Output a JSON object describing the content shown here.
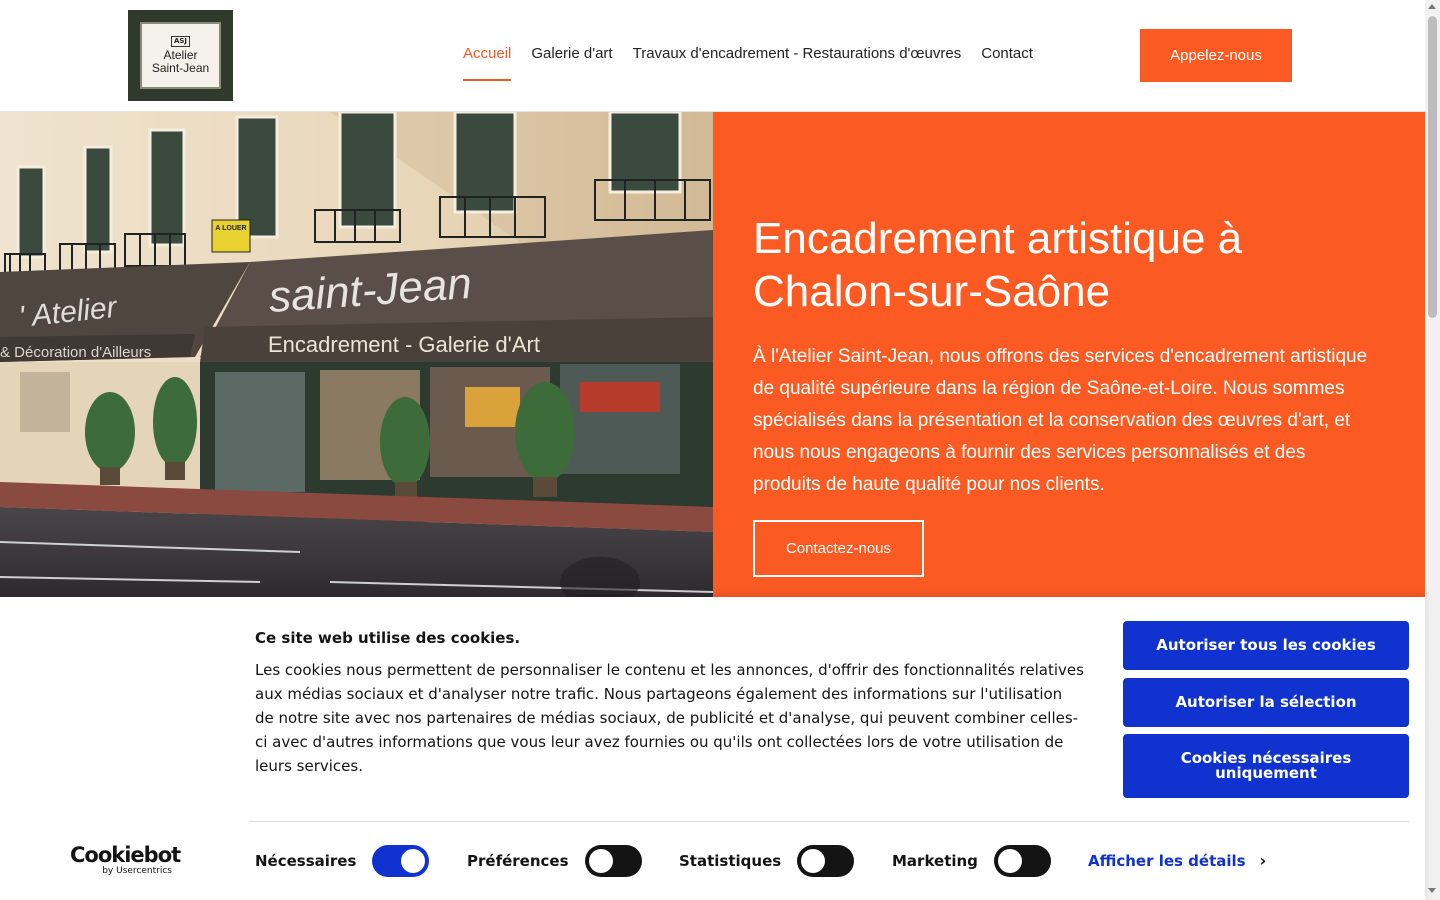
{
  "logo": {
    "mark": "ASJ",
    "line1": "Atelier",
    "line2": "Saint-Jean"
  },
  "nav": {
    "items": [
      {
        "label": "Accueil",
        "active": true
      },
      {
        "label": "Galerie d'art",
        "active": false
      },
      {
        "label": "Travaux d'encadrement - Restaurations d'œuvres",
        "active": false
      },
      {
        "label": "Contact",
        "active": false
      }
    ],
    "call_label": "Appelez-nous"
  },
  "hero": {
    "awning_left": "' Atelier",
    "awning_left_sub": "& Décoration d'Ailleurs",
    "awning_main": "saint-Jean",
    "awning_sub": "Encadrement - Galerie d'Art",
    "sign": "A LOUER",
    "title": "Encadrement artistique à Chalon-sur-Saône",
    "text": "À l'Atelier Saint-Jean, nous offrons des services d'encadrement artistique de qualité supérieure dans la région de Saône-et-Loire. Nous sommes spécialisés dans la présentation et la conservation des œuvres d'art, et nous nous engageons à fournir des services personnalisés et des produits de haute qualité pour nos clients.",
    "button": "Contactez-nous"
  },
  "cookie": {
    "title": "Ce site web utilise des cookies.",
    "text": "Les cookies nous permettent de personnaliser le contenu et les annonces, d'offrir des fonctionnalités relatives aux médias sociaux et d'analyser notre trafic. Nous partageons également des informations sur l'utilisation de notre site avec nos partenaires de médias sociaux, de publicité et d'analyse, qui peuvent combiner celles-ci avec d'autres informations que vous leur avez fournies ou qu'ils ont collectées lors de votre utilisation de leurs services.",
    "btn_all": "Autoriser tous les cookies",
    "btn_selection": "Autoriser la sélection",
    "btn_necessary": "Cookies nécessaires uniquement",
    "brand": "Cookiebot",
    "brand_sub": "by Usercentrics",
    "toggles": [
      {
        "label": "Nécessaires",
        "on": true
      },
      {
        "label": "Préférences",
        "on": false
      },
      {
        "label": "Statistiques",
        "on": false
      },
      {
        "label": "Marketing",
        "on": false
      }
    ],
    "details": "Afficher les détails"
  },
  "colors": {
    "accent": "#fb5a23",
    "cookie_blue": "#1032cf"
  }
}
